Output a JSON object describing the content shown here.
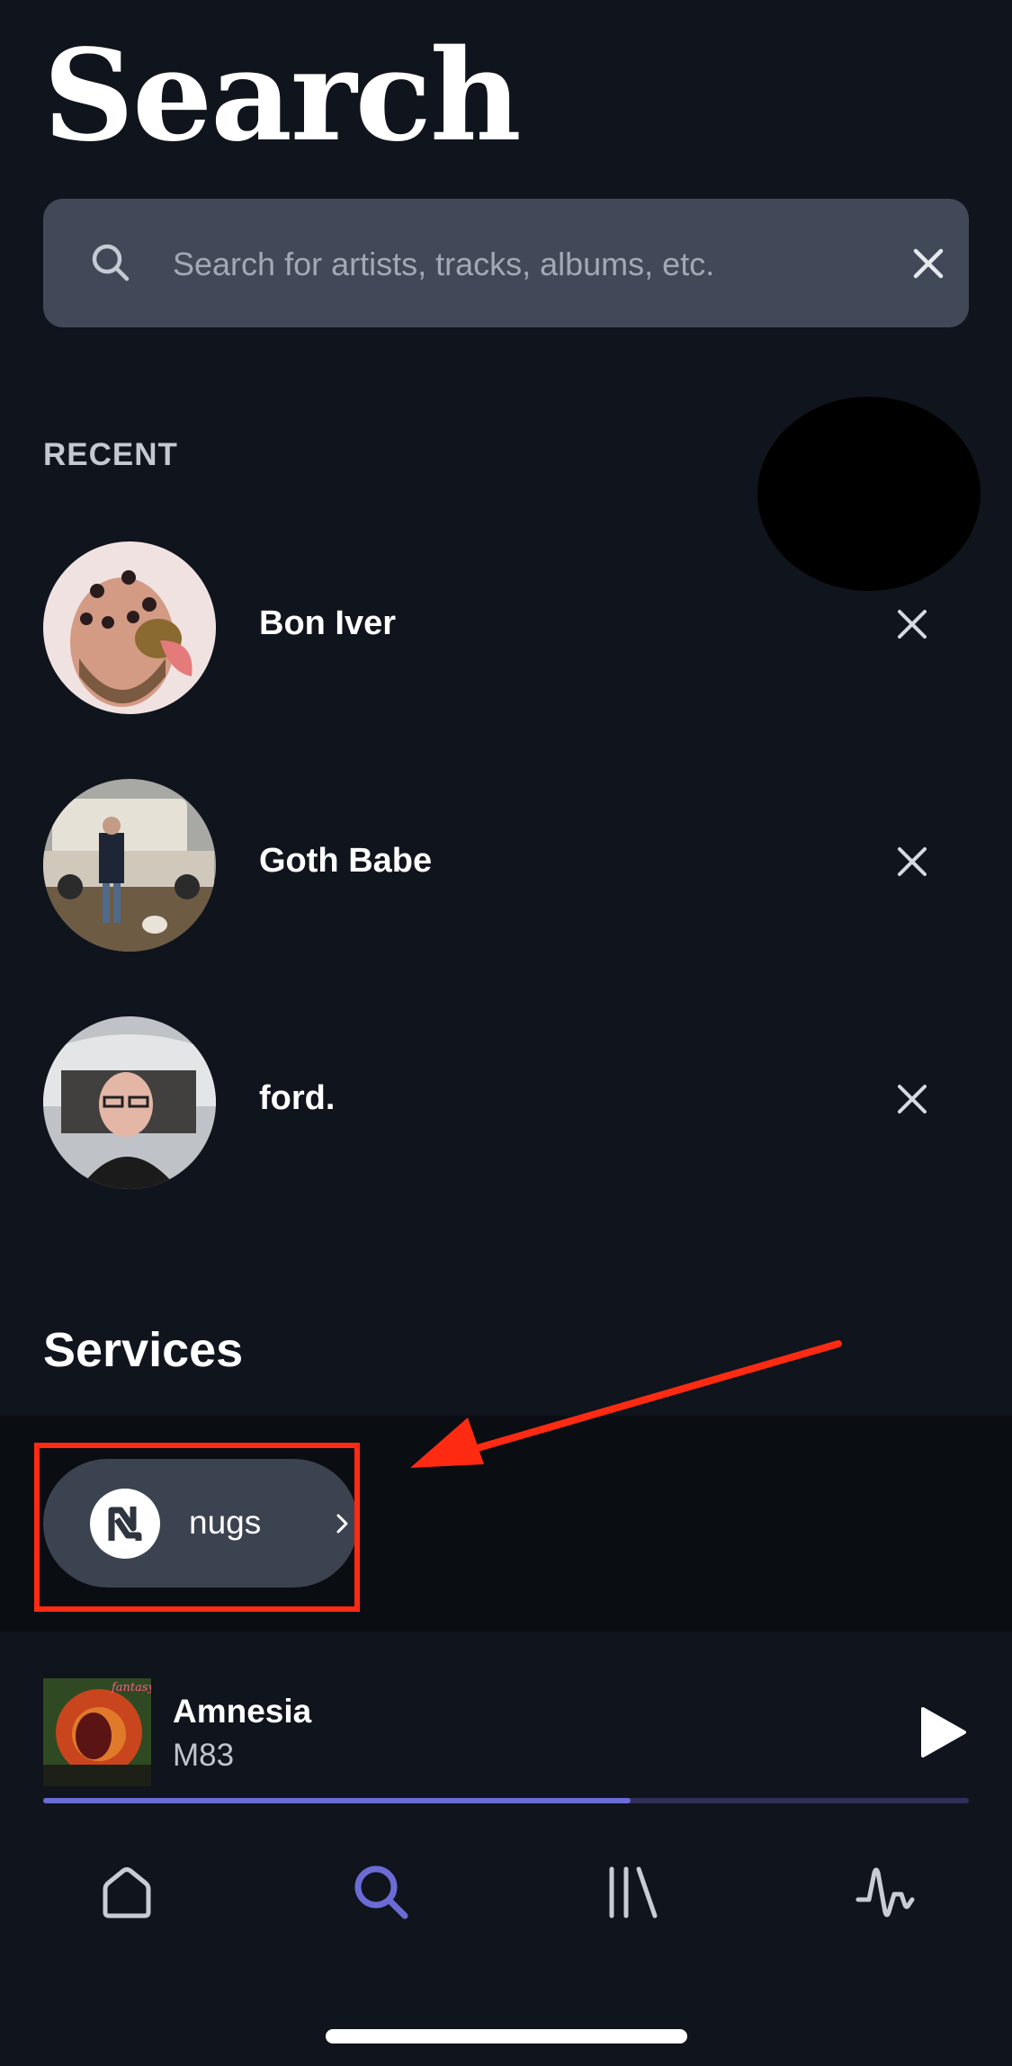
{
  "header": {
    "title": "Search"
  },
  "search": {
    "placeholder": "Search for artists, tracks, albums, etc.",
    "value": ""
  },
  "recent": {
    "heading": "RECENT",
    "items": [
      {
        "name": "Bon Iver"
      },
      {
        "name": "Goth Babe"
      },
      {
        "name": "ford."
      }
    ]
  },
  "services": {
    "heading": "Services",
    "items": [
      {
        "label": "nugs"
      }
    ]
  },
  "now_playing": {
    "title": "Amnesia",
    "artist": "M83",
    "album_art_text": "fantasy",
    "progress": 0.635
  },
  "nav": {
    "items": [
      {
        "icon": "home-icon",
        "active": false
      },
      {
        "icon": "search-icon",
        "active": true
      },
      {
        "icon": "library-icon",
        "active": false
      },
      {
        "icon": "waveform-icon",
        "active": false
      }
    ]
  },
  "colors": {
    "background": "#10141c",
    "search_bar": "#414958",
    "accent": "#6b6bd6",
    "annotation": "#ff2a12"
  }
}
